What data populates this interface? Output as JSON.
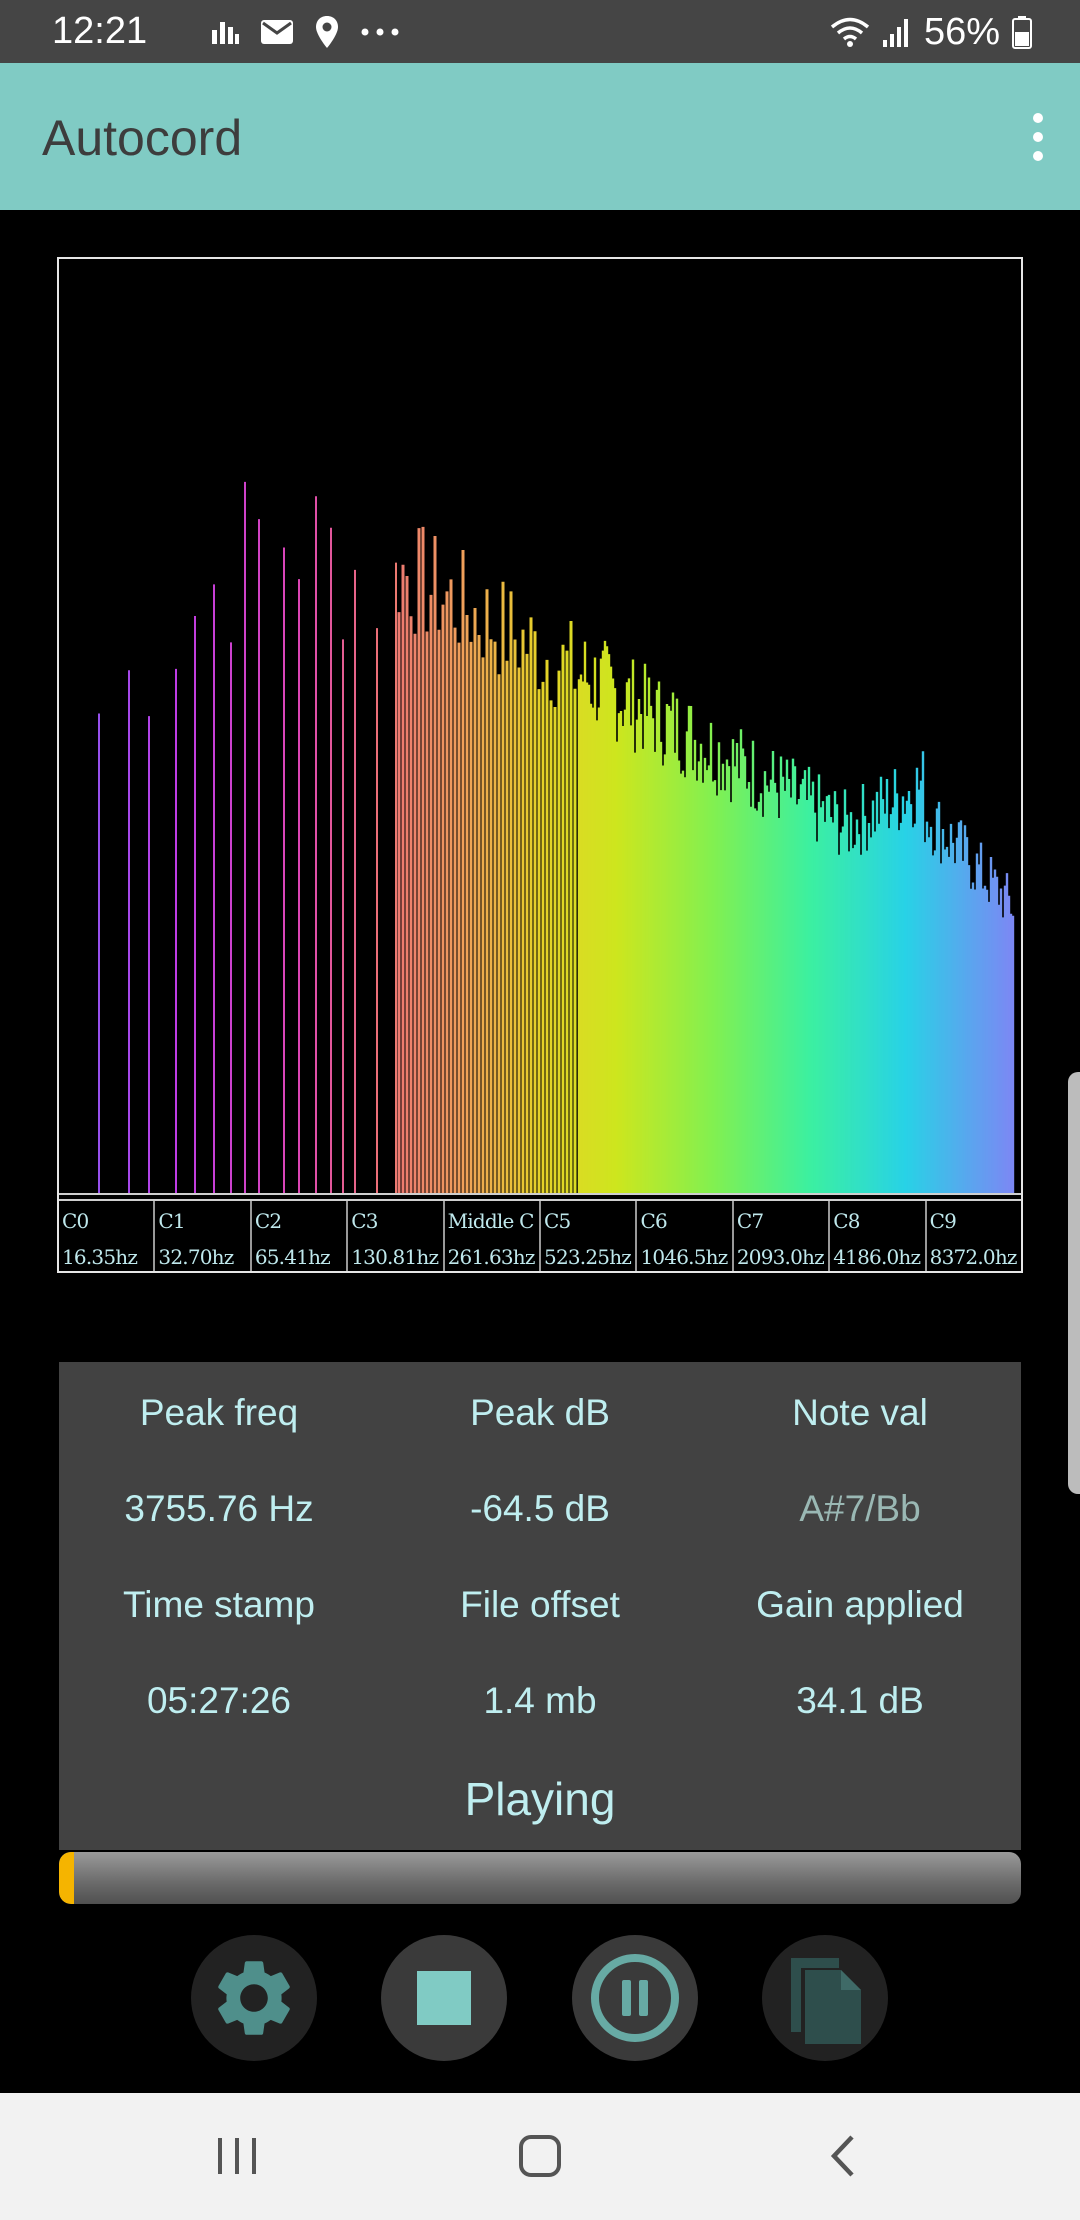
{
  "status_bar": {
    "time": "12:21",
    "battery": "56%",
    "left_icons": [
      "activity-icon",
      "mail-icon",
      "location-icon",
      "more-dots-icon"
    ],
    "right_icons": [
      "wifi-icon",
      "signal-icon",
      "battery-icon"
    ]
  },
  "app_bar": {
    "title": "Autocord",
    "menu_icon": "overflow-menu-icon",
    "color": "#80cbc4"
  },
  "spectrum": {
    "octaves": [
      {
        "note": "C0",
        "freq": "16.35hz"
      },
      {
        "note": "C1",
        "freq": "32.70hz"
      },
      {
        "note": "C2",
        "freq": "65.41hz"
      },
      {
        "note": "C3",
        "freq": "130.81hz"
      },
      {
        "note": "Middle C",
        "freq": "261.63hz"
      },
      {
        "note": "C5",
        "freq": "523.25hz"
      },
      {
        "note": "C6",
        "freq": "1046.5hz"
      },
      {
        "note": "C7",
        "freq": "2093.0hz"
      },
      {
        "note": "C8",
        "freq": "4186.0hz"
      },
      {
        "note": "C9",
        "freq": "8372.0hz"
      }
    ]
  },
  "readout": {
    "labels": [
      "Peak freq",
      "Peak dB",
      "Note val",
      "Time stamp",
      "File offset",
      "Gain applied"
    ],
    "peak_freq": "3755.76 Hz",
    "peak_db": "-64.5 dB",
    "note_val": "A#7/Bb",
    "time_stamp": "05:27:26",
    "file_offset": "1.4 mb",
    "gain_applied": "34.1 dB",
    "state": "Playing"
  },
  "playback": {
    "progress": 0.016,
    "progress_color": "#f5b400"
  },
  "controls": [
    "settings-icon",
    "stop-icon",
    "pause-icon",
    "file-icon"
  ],
  "nav": [
    "recents-icon",
    "home-icon",
    "back-icon"
  ]
}
